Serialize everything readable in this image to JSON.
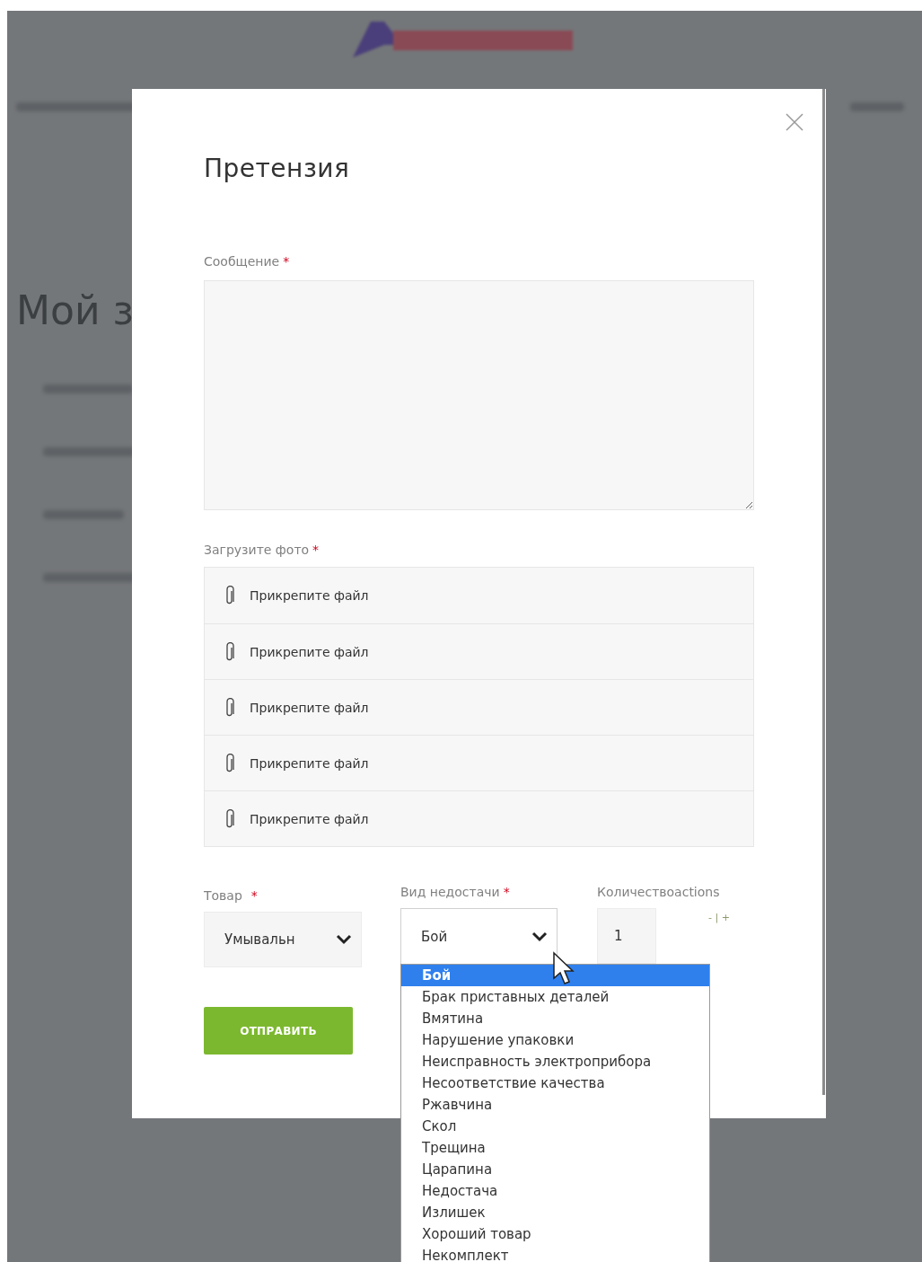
{
  "background": {
    "heading": "Мой з"
  },
  "modal": {
    "title": "Претензия",
    "required_mark": "*",
    "message": {
      "label": "Сообщение",
      "required": true
    },
    "photos": {
      "label": "Загрузите фото",
      "required": true,
      "files": [
        {
          "label": "Прикрепите файл"
        },
        {
          "label": "Прикрепите файл"
        },
        {
          "label": "Прикрепите файл"
        },
        {
          "label": "Прикрепите файл"
        },
        {
          "label": "Прикрепите файл"
        }
      ]
    },
    "product": {
      "label": "Товар",
      "required": true,
      "value": "Умывальн"
    },
    "defect": {
      "label": "Вид недостачи",
      "required": true,
      "value": "Бой",
      "expanded": true,
      "options": [
        {
          "label": "Бой",
          "selected": true
        },
        {
          "label": "Брак приставных деталей",
          "selected": false
        },
        {
          "label": "Вмятина",
          "selected": false
        },
        {
          "label": "Нарушение упаковки",
          "selected": false
        },
        {
          "label": "Неисправность электроприбора",
          "selected": false
        },
        {
          "label": "Несоответствие качества",
          "selected": false
        },
        {
          "label": "Ржавчина",
          "selected": false
        },
        {
          "label": "Скол",
          "selected": false
        },
        {
          "label": "Трещина",
          "selected": false
        },
        {
          "label": "Царапина",
          "selected": false
        },
        {
          "label": "Недостача",
          "selected": false
        },
        {
          "label": "Излишек",
          "selected": false
        },
        {
          "label": "Хороший товар",
          "selected": false
        },
        {
          "label": "Некомплект",
          "selected": false
        }
      ]
    },
    "quantity": {
      "label": "Количествоactions",
      "required": false,
      "value": "1",
      "stepper": "- | +"
    },
    "submit": "ОТПРАВИТЬ"
  }
}
